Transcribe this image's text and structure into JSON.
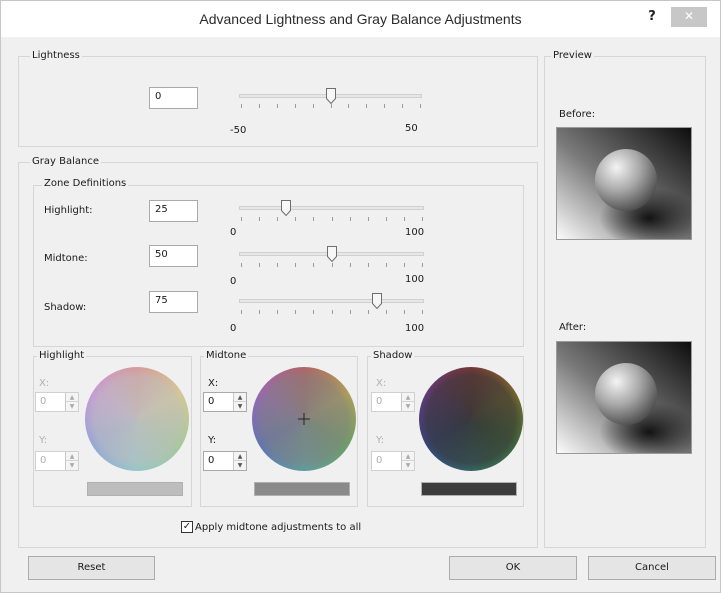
{
  "window": {
    "title": "Advanced Lightness and Gray Balance Adjustments",
    "help_label": "?",
    "close_label": "✕"
  },
  "lightness": {
    "group_label": "Lightness",
    "value": "0",
    "min_label": "-50",
    "max_label": "50",
    "slider_fraction": 0.5
  },
  "gray_balance": {
    "group_label": "Gray Balance",
    "zone_definitions": {
      "group_label": "Zone Definitions",
      "highlight": {
        "label": "Highlight:",
        "value": "25",
        "min_label": "0",
        "max_label": "100",
        "slider_fraction": 0.25
      },
      "midtone": {
        "label": "Midtone:",
        "value": "50",
        "min_label": "0",
        "max_label": "100",
        "slider_fraction": 0.5
      },
      "shadow": {
        "label": "Shadow:",
        "value": "75",
        "min_label": "0",
        "max_label": "100",
        "slider_fraction": 0.75
      }
    },
    "highlight": {
      "label": "Highlight",
      "x_label": "X:",
      "x_value": "0",
      "y_label": "Y:",
      "y_value": "0",
      "swatch_color": "#bdbdbd",
      "enabled": false
    },
    "midtone": {
      "label": "Midtone",
      "x_label": "X:",
      "x_value": "0",
      "y_label": "Y:",
      "y_value": "0",
      "swatch_color": "#8a8a8a",
      "enabled": true
    },
    "shadow": {
      "label": "Shadow",
      "x_label": "X:",
      "x_value": "0",
      "y_label": "Y:",
      "y_value": "0",
      "swatch_color": "#3c3c3c",
      "enabled": false
    },
    "apply_all": {
      "label": "Apply midtone adjustments to all",
      "checked": true,
      "check_glyph": "✓"
    }
  },
  "preview": {
    "group_label": "Preview",
    "before_label": "Before:",
    "after_label": "After:"
  },
  "buttons": {
    "reset": "Reset",
    "ok": "OK",
    "cancel": "Cancel"
  }
}
